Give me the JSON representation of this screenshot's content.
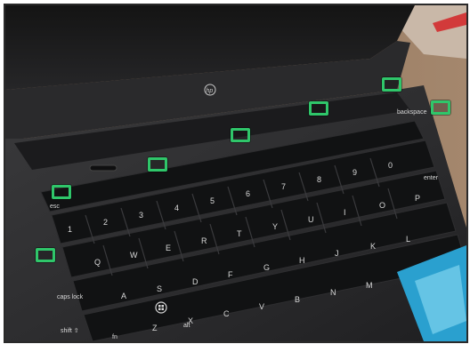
{
  "image": {
    "subject": "laptop-keyboard-photo",
    "brand_logo": "hp",
    "marker_color": "#2fc66a"
  },
  "markers": [
    {
      "id": "marker-1"
    },
    {
      "id": "marker-2"
    },
    {
      "id": "marker-3"
    },
    {
      "id": "marker-4"
    },
    {
      "id": "marker-5"
    },
    {
      "id": "marker-6"
    },
    {
      "id": "marker-7"
    }
  ],
  "keys": {
    "row_numbers": [
      "1",
      "2",
      "3",
      "4",
      "5",
      "6",
      "7",
      "8",
      "9",
      "0"
    ],
    "row_top": [
      "Q",
      "W",
      "E",
      "R",
      "T",
      "Y",
      "U",
      "I",
      "O",
      "P"
    ],
    "row_home": [
      "A",
      "S",
      "D",
      "F",
      "G",
      "H",
      "J",
      "K",
      "L"
    ],
    "row_bottom": [
      "Z",
      "X",
      "C",
      "V",
      "B",
      "N",
      "M"
    ],
    "caps_lock": "caps lock",
    "shift": "shift ⇧",
    "fn": "fn",
    "alt": "alt",
    "backspace": "backspace",
    "enter": "enter",
    "esc": "esc"
  }
}
